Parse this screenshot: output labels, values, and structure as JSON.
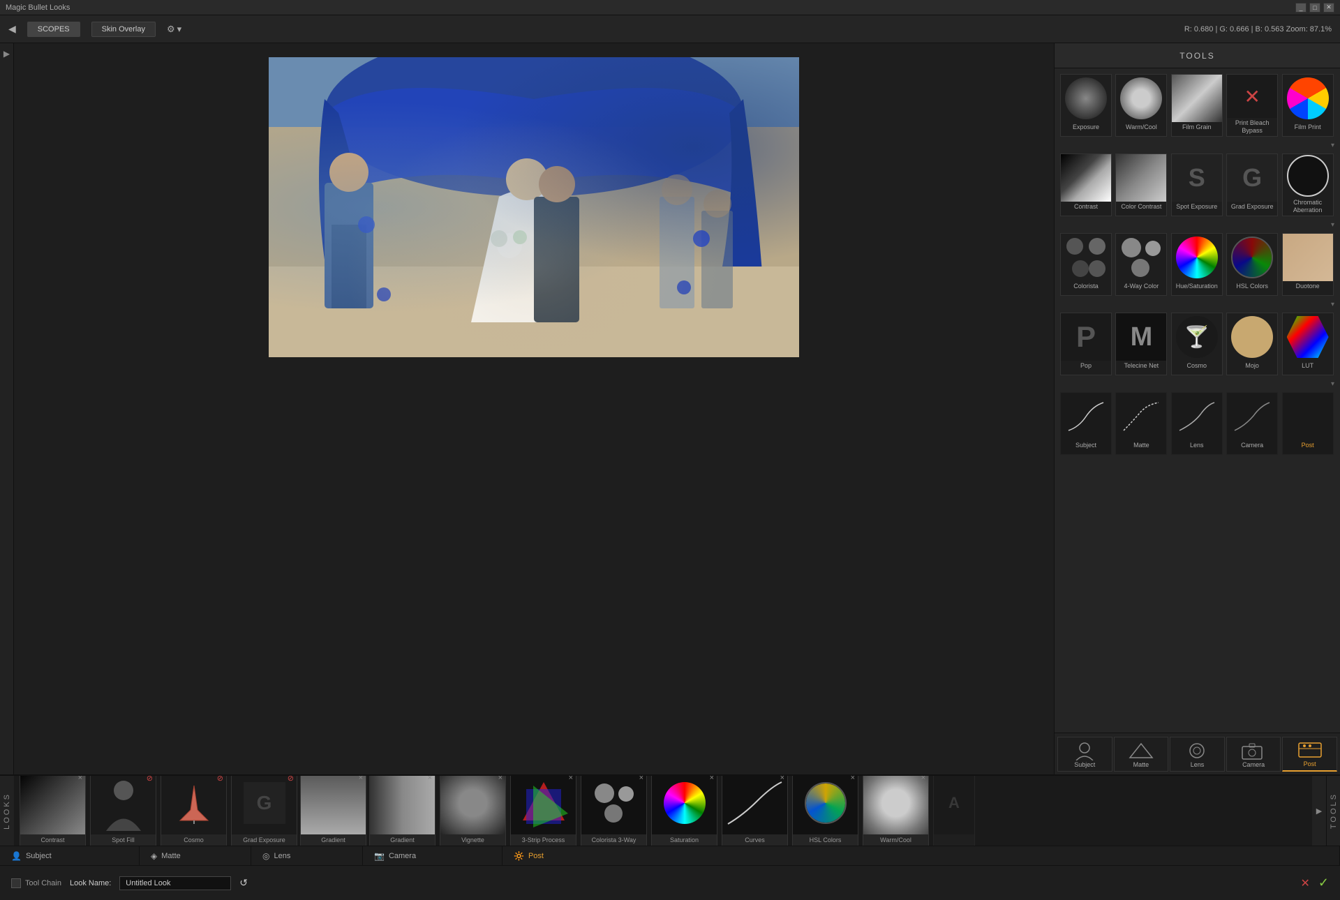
{
  "app": {
    "title": "Magic Bullet Looks",
    "title_controls": [
      "_",
      "□",
      "✕"
    ]
  },
  "topbar": {
    "scopes_label": "SCOPES",
    "skin_overlay": "Skin Overlay",
    "color_readout": "R: 0.680 | G: 0.666 | B: 0.563   Zoom: 87.1%",
    "settings_icon": "⚙"
  },
  "tools": {
    "header": "TOOLS",
    "rows": [
      {
        "items": [
          {
            "id": "exposure",
            "label": "Exposure"
          },
          {
            "id": "warmcool",
            "label": "Warm/Cool"
          },
          {
            "id": "filmgrain",
            "label": "Film Grain"
          },
          {
            "id": "bleach",
            "label": "Print Bleach Bypass"
          },
          {
            "id": "filmprint",
            "label": "Film Print"
          }
        ]
      },
      {
        "separator": true
      },
      {
        "items": [
          {
            "id": "contrast",
            "label": "Contrast"
          },
          {
            "id": "colorcontrast",
            "label": "Color Contrast"
          },
          {
            "id": "spotexposure",
            "label": "Spot Exposure"
          },
          {
            "id": "gradexposure",
            "label": "Grad Exposure"
          },
          {
            "id": "chromatic",
            "label": "Chromatic Aberration"
          }
        ]
      },
      {
        "separator": true
      },
      {
        "items": [
          {
            "id": "colorista",
            "label": "Colorista"
          },
          {
            "id": "fourwaycolor",
            "label": "4-Way Color"
          },
          {
            "id": "huesaturation",
            "label": "Hue/Saturation"
          },
          {
            "id": "hslcolors",
            "label": "HSL Colors"
          },
          {
            "id": "duotone",
            "label": "Duotone"
          }
        ]
      },
      {
        "separator": true
      },
      {
        "items": [
          {
            "id": "pop",
            "label": "Pop"
          },
          {
            "id": "telecinenet",
            "label": "Telecine Net"
          },
          {
            "id": "cosmo",
            "label": "Cosmo"
          },
          {
            "id": "mojo",
            "label": "Mojo"
          },
          {
            "id": "lut",
            "label": "LUT"
          }
        ]
      },
      {
        "separator": true
      },
      {
        "items": [
          {
            "id": "subject_curve",
            "label": "Subject"
          },
          {
            "id": "matte_curve",
            "label": "Matte"
          },
          {
            "id": "lens_curve",
            "label": "Lens"
          },
          {
            "id": "camera_curve",
            "label": "Camera"
          },
          {
            "id": "post_label",
            "label": "Post",
            "highlight": true
          }
        ]
      }
    ],
    "pipeline_tabs": [
      {
        "id": "subject",
        "label": "Subject",
        "icon": "person"
      },
      {
        "id": "matte",
        "label": "Matte",
        "icon": "matte"
      },
      {
        "id": "lens",
        "label": "Lens",
        "icon": "lens"
      },
      {
        "id": "camera",
        "label": "Camera",
        "icon": "camera"
      },
      {
        "id": "post",
        "label": "Post",
        "icon": "post",
        "active": true
      }
    ]
  },
  "looks_strip": {
    "labels": [
      "L",
      "O",
      "O",
      "K",
      "S"
    ],
    "items": [
      {
        "id": "contrast",
        "label": "Contrast",
        "type": "contrast",
        "has_close": true,
        "close_color": "normal"
      },
      {
        "id": "spot_fill",
        "label": "Spot Fill",
        "type": "portrait",
        "has_close": true,
        "close_color": "red"
      },
      {
        "id": "cosmo",
        "label": "Cosmo",
        "type": "cosmo",
        "has_close": true,
        "close_color": "red"
      },
      {
        "id": "empty1",
        "label": "",
        "type": "empty",
        "has_close": false,
        "close_color": "normal"
      },
      {
        "id": "grad_exposure",
        "label": "Grad Exposure",
        "type": "gradexp",
        "has_close": true,
        "close_color": "red"
      },
      {
        "id": "gradient",
        "label": "Gradient",
        "type": "gradient",
        "has_close": true,
        "close_color": "normal"
      },
      {
        "id": "gradient2",
        "label": "Gradient",
        "type": "gradient2",
        "has_close": true,
        "close_color": "normal"
      },
      {
        "id": "empty2",
        "label": "Vignette",
        "type": "vignette",
        "has_close": true,
        "close_color": "normal"
      },
      {
        "id": "threestrip",
        "label": "3-Strip Process",
        "type": "threestrip",
        "has_close": true,
        "close_color": "normal"
      },
      {
        "id": "colorista3",
        "label": "Colorista 3-Way",
        "type": "colorista3",
        "has_close": true,
        "close_color": "normal"
      },
      {
        "id": "saturation",
        "label": "Saturation",
        "type": "saturation",
        "has_close": true,
        "close_color": "normal"
      },
      {
        "id": "curves",
        "label": "Curves",
        "type": "curves",
        "has_close": true,
        "close_color": "normal"
      },
      {
        "id": "hslcolors",
        "label": "HSL Colors",
        "type": "hslcolors",
        "has_close": true,
        "close_color": "normal"
      },
      {
        "id": "warmcool",
        "label": "Warm/Cool",
        "type": "warmcool",
        "has_close": true,
        "close_color": "normal"
      },
      {
        "id": "extra",
        "label": "",
        "type": "extra",
        "has_close": false,
        "close_color": "normal"
      }
    ]
  },
  "pipeline_labels": [
    {
      "id": "subject",
      "label": "Subject",
      "icon": "👤",
      "active": false
    },
    {
      "id": "matte",
      "label": "Matte",
      "icon": "⬥",
      "active": false
    },
    {
      "id": "lens",
      "label": "Lens",
      "icon": "◎",
      "active": false
    },
    {
      "id": "camera",
      "label": "Camera",
      "icon": "📷",
      "active": false
    },
    {
      "id": "post",
      "label": "Post",
      "icon": "🔆",
      "active": true
    }
  ],
  "toolbar": {
    "tool_chain_label": "Tool Chain",
    "look_name_label": "Look Name:",
    "look_name_value": "Untitled Look",
    "reset_label": "↺",
    "cancel_label": "✕",
    "ok_label": "✓"
  }
}
